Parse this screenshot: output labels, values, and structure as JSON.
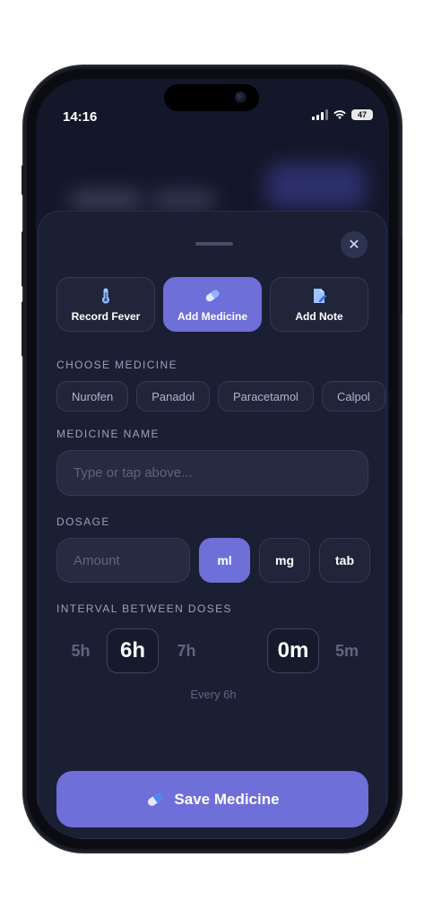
{
  "status_bar": {
    "time": "14:16",
    "battery": "47"
  },
  "tabs": [
    {
      "label": "Record Fever",
      "icon": "thermometer-icon",
      "active": false
    },
    {
      "label": "Add Medicine",
      "icon": "pill-icon",
      "active": true
    },
    {
      "label": "Add Note",
      "icon": "note-icon",
      "active": false
    }
  ],
  "choose_medicine": {
    "label": "CHOOSE MEDICINE",
    "options": [
      "Nurofen",
      "Panadol",
      "Paracetamol",
      "Calpol"
    ]
  },
  "medicine_name": {
    "label": "MEDICINE NAME",
    "placeholder": "Type or tap above..."
  },
  "dosage": {
    "label": "DOSAGE",
    "amount_placeholder": "Amount",
    "units": [
      "ml",
      "mg",
      "tab"
    ],
    "selected_unit": "ml"
  },
  "interval": {
    "label": "INTERVAL BETWEEN DOSES",
    "hours_prev": "5h",
    "hours_selected": "6h",
    "hours_next": "7h",
    "minutes_selected": "0m",
    "minutes_next": "5m",
    "summary": "Every 6h"
  },
  "save_button": {
    "label": "Save Medicine",
    "icon": "pill-icon"
  },
  "colors": {
    "accent": "#6f6fd9",
    "sheet": "#1b1f33",
    "background": "#14172a"
  }
}
